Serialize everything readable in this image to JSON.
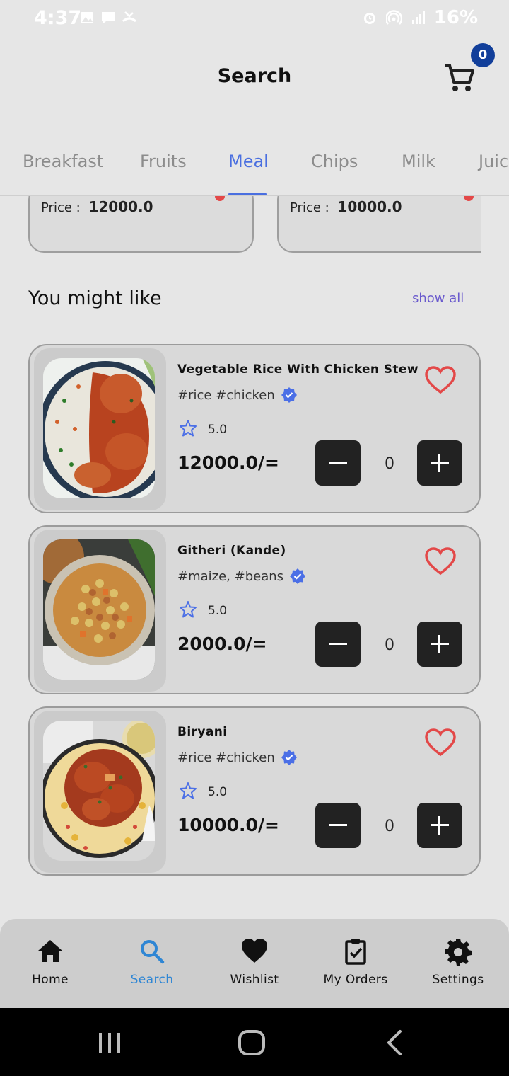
{
  "status_bar": {
    "time": "4:37",
    "battery": "16%"
  },
  "header": {
    "title": "Search",
    "cart_count": "0"
  },
  "tabs": [
    {
      "label": "Breakfast"
    },
    {
      "label": "Fruits"
    },
    {
      "label": "Meal",
      "active": true
    },
    {
      "label": "Chips"
    },
    {
      "label": "Milk"
    },
    {
      "label": "Juic"
    }
  ],
  "peek_cards": [
    {
      "price_label": "Price",
      "price_sep": ":",
      "price": "12000.0"
    },
    {
      "price_label": "Price",
      "price_sep": ":",
      "price": "10000.0"
    }
  ],
  "section": {
    "title": "You might like",
    "show_all": "show all"
  },
  "products": [
    {
      "name": "Vegetable Rice With Chicken Stew",
      "tags": "#rice #chicken",
      "rating": "5.0",
      "price": "12000.0/=",
      "qty": "0"
    },
    {
      "name": "Githeri (Kande)",
      "tags": "#maize, #beans",
      "rating": "5.0",
      "price": "2000.0/=",
      "qty": "0"
    },
    {
      "name": "Biryani",
      "tags": "#rice #chicken",
      "rating": "5.0",
      "price": "10000.0/=",
      "qty": "0"
    }
  ],
  "bottom_nav": [
    {
      "label": "Home",
      "icon": "home-icon"
    },
    {
      "label": "Search",
      "icon": "search-icon",
      "active": true
    },
    {
      "label": "Wishlist",
      "icon": "heart-icon"
    },
    {
      "label": "My Orders",
      "icon": "clipboard-check-icon"
    },
    {
      "label": "Settings",
      "icon": "gear-icon"
    }
  ],
  "colors": {
    "accent": "#4a6fe0",
    "active_nav": "#2f86d4",
    "heart": "#e34848",
    "badge": "#123f9a"
  }
}
